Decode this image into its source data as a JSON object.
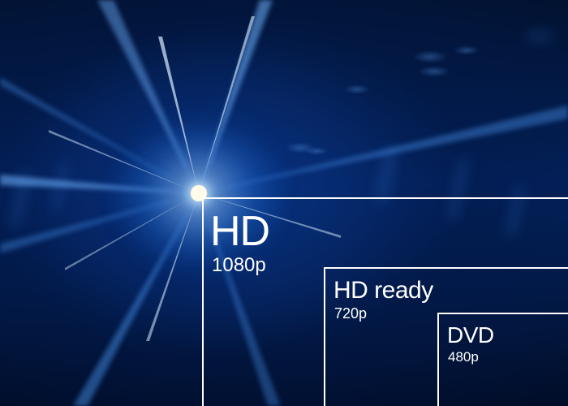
{
  "resolutions": [
    {
      "title": "HD",
      "subtitle": "1080p"
    },
    {
      "title": "HD ready",
      "subtitle": "720p"
    },
    {
      "title": "DVD",
      "subtitle": "480p"
    }
  ],
  "colors": {
    "background_deep": "#01102e",
    "background_mid": "#03215a",
    "glow": "#2a8cff",
    "flare_core": "#fff6d8",
    "frame_lines": "#ffffff"
  }
}
